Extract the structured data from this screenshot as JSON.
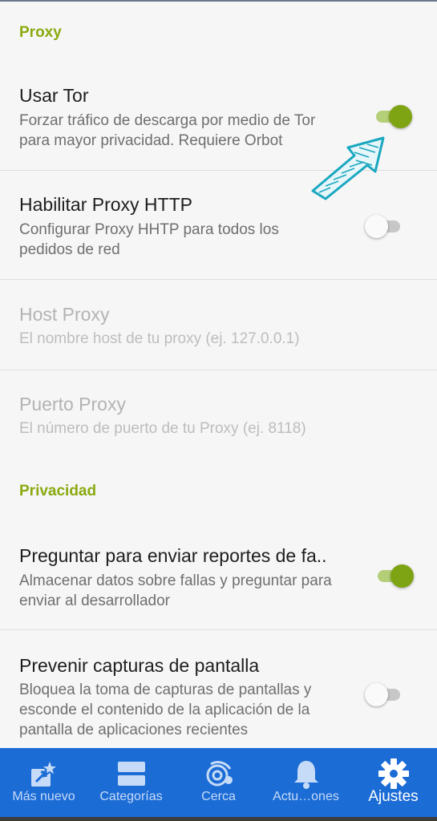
{
  "sections": {
    "proxy": "Proxy",
    "privacy": "Privacidad"
  },
  "prefs": {
    "use_tor": {
      "title": "Usar Tor",
      "summary": "Forzar tráfico de descarga por medio de Tor para mayor privacidad. Requiere Orbot",
      "enabled": true
    },
    "http_proxy": {
      "title": "Habilitar Proxy HTTP",
      "summary": "Configurar Proxy HHTP para todos los pedidos de red",
      "enabled": false
    },
    "proxy_host": {
      "title": "Host Proxy",
      "summary": "El nombre host de tu proxy (ej. 127.0.0.1)"
    },
    "proxy_port": {
      "title": "Puerto Proxy",
      "summary": "El número de puerto de tu Proxy (ej. 8118)"
    },
    "crash_reports": {
      "title": "Preguntar para enviar reportes de fa..",
      "summary": "Almacenar datos sobre fallas y preguntar para enviar al desarrollador",
      "enabled": true
    },
    "prevent_screenshots": {
      "title": "Prevenir capturas de pantalla",
      "summary": "Bloquea la toma de capturas de pantallas y esconde el contenido de la aplicación de la pantalla de aplicaciones recientes",
      "enabled": false
    }
  },
  "nav": {
    "items": [
      {
        "label": "Más nuevo",
        "icon": "star-box-icon"
      },
      {
        "label": "Categorías",
        "icon": "categories-icon"
      },
      {
        "label": "Cerca",
        "icon": "nearby-icon"
      },
      {
        "label": "Actu…ones",
        "icon": "bell-icon"
      },
      {
        "label": "Ajustes",
        "icon": "gear-icon"
      }
    ],
    "active": "Ajustes"
  },
  "colors": {
    "accent_green": "#8aaa10",
    "nav_blue": "#1c6cd6",
    "annotation_arrow": "#1aa7c0"
  }
}
